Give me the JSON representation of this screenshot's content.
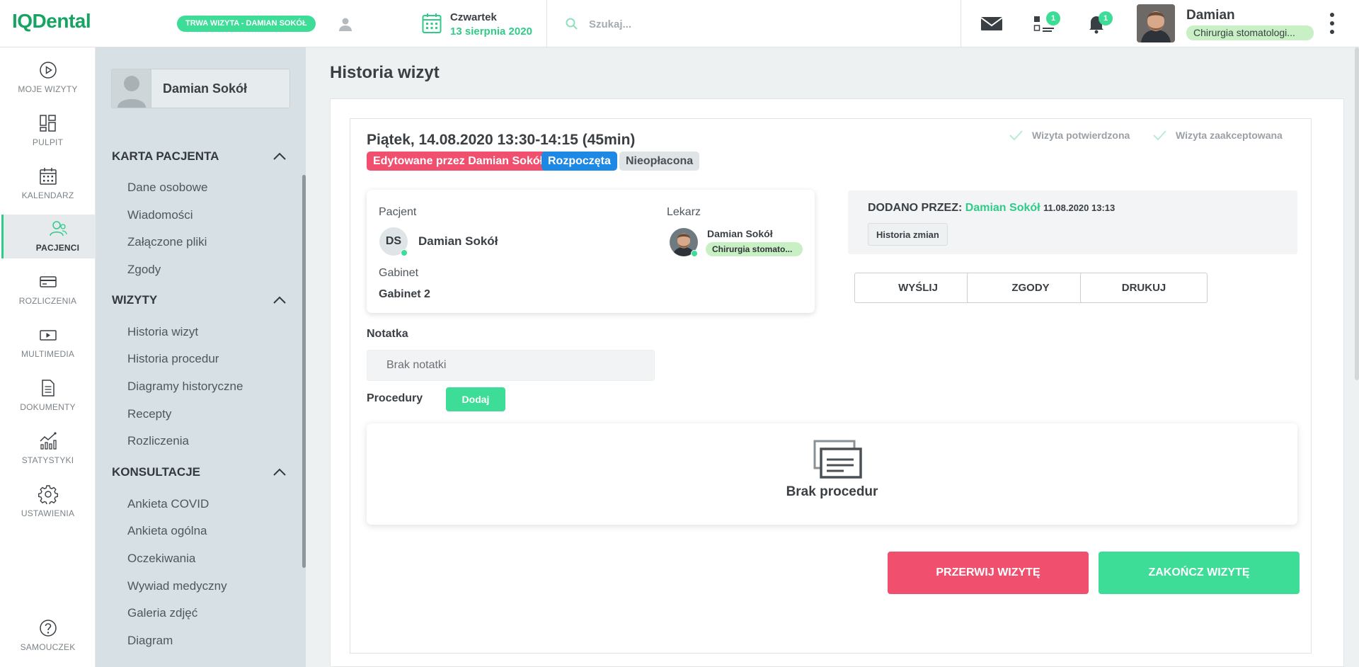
{
  "app": {
    "logo": "IQDental"
  },
  "topbar": {
    "visit_status": "TRWA WIZYTA - DAMIAN SOKÓŁ",
    "day_name": "Czwartek",
    "date": "13 sierpnia 2020",
    "search_placeholder": "Szukaj...",
    "tasks_badge": "1",
    "notifications_badge": "1",
    "user_name": "Damian",
    "user_role": "Chirurgia stomatologi..."
  },
  "leftnav": {
    "items": [
      {
        "label": "MOJE WIZYTY",
        "icon": "play-circle-icon"
      },
      {
        "label": "PULPIT",
        "icon": "dashboard-icon"
      },
      {
        "label": "KALENDARZ",
        "icon": "calendar-icon"
      },
      {
        "label": "PACJENCI",
        "icon": "patients-icon"
      },
      {
        "label": "ROZLICZENIA",
        "icon": "credit-card-icon"
      },
      {
        "label": "MULTIMEDIA",
        "icon": "multimedia-icon"
      },
      {
        "label": "DOKUMENTY",
        "icon": "document-icon"
      },
      {
        "label": "STATYSTYKI",
        "icon": "statistics-icon"
      },
      {
        "label": "USTAWIENIA",
        "icon": "gear-icon"
      }
    ],
    "help_label": "SAMOUCZEK"
  },
  "subnav": {
    "patient_name": "Damian Sokół",
    "sections": [
      {
        "title": "KARTA PACJENTA",
        "links": [
          "Dane osobowe",
          "Wiadomości",
          "Załączone pliki",
          "Zgody"
        ]
      },
      {
        "title": "WIZYTY",
        "links": [
          "Historia wizyt",
          "Historia procedur",
          "Diagramy historyczne",
          "Recepty",
          "Rozliczenia"
        ]
      },
      {
        "title": "KONSULTACJE",
        "links": [
          "Ankieta COVID",
          "Ankieta ogólna",
          "Oczekiwania",
          "Wywiad medyczny",
          "Galeria zdjęć",
          "Diagram"
        ]
      }
    ]
  },
  "main": {
    "page_title": "Historia wizyt",
    "visit": {
      "title": "Piątek, 14.08.2020 13:30-14:15 (45min)",
      "tags": {
        "edited": "Edytowane przez Damian Sokół",
        "started": "Rozpoczęta",
        "unpaid": "Nieopłacona"
      },
      "status_confirmed": "Wizyta potwierdzona",
      "status_accepted": "Wizyta zaakceptowana",
      "patient_label": "Pacjent",
      "patient_initials": "DS",
      "patient_name": "Damian Sokół",
      "doctor_label": "Lekarz",
      "doctor_name": "Damian Sokół",
      "doctor_role": "Chirurgia stomato...",
      "office_label": "Gabinet",
      "office_name": "Gabinet 2",
      "added_by_label": "DODANO PRZEZ:",
      "added_by_name": "Damian Sokół",
      "added_by_time": "11.08.2020 13:13",
      "history_button": "Historia zmian",
      "send_button": "WYŚLIJ",
      "consents_button": "ZGODY",
      "print_button": "DRUKUJ",
      "note_label": "Notatka",
      "note_value": "Brak notatki",
      "procedures_label": "Procedury",
      "add_button": "Dodaj",
      "no_procedures": "Brak procedur",
      "interrupt_button": "PRZERWIJ WIZYTĘ",
      "finish_button": "ZAKOŃCZ WIZYTĘ"
    }
  },
  "colors": {
    "accent_green": "#3ddc97",
    "brand_green": "#17a463",
    "danger_red": "#f0506e",
    "info_blue": "#1e88e5"
  }
}
